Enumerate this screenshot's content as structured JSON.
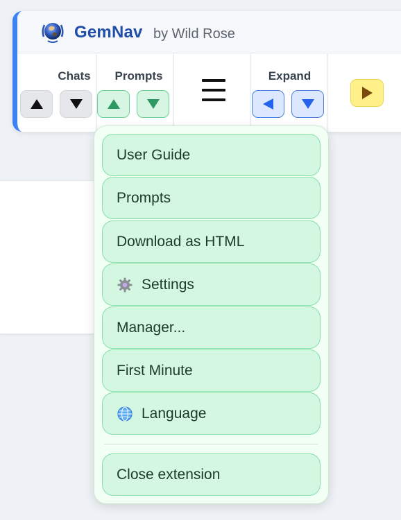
{
  "app": {
    "name": "GemNav",
    "author": "by Wild Rose",
    "logo_icon": "globe-wreath-icon"
  },
  "toolbar": {
    "groups": [
      {
        "label": "Chats",
        "up_icon": "triangle-up-icon",
        "down_icon": "triangle-down-icon"
      },
      {
        "label": "Prompts",
        "up_icon": "triangle-up-icon",
        "down_icon": "triangle-down-icon"
      },
      {
        "label": "Expand",
        "left_icon": "triangle-left-icon",
        "down_icon": "triangle-down-icon"
      }
    ],
    "menu_icon": "hamburger-icon",
    "play_icon": "play-icon"
  },
  "menu": {
    "items": [
      {
        "label": "User Guide"
      },
      {
        "label": "Prompts"
      },
      {
        "label": "Download as HTML"
      },
      {
        "label": "Settings",
        "icon": "gear-icon"
      },
      {
        "label": "Manager..."
      },
      {
        "label": "First Minute"
      },
      {
        "label": "Language",
        "icon": "globe-icon"
      }
    ],
    "close_label": "Close extension"
  },
  "colors": {
    "accent": "#3b82f6",
    "brand_text": "#1f4fa8",
    "menu_item_bg": "#d4f7e2",
    "menu_item_border": "#86e0a8",
    "play_button": "#fff08a"
  }
}
